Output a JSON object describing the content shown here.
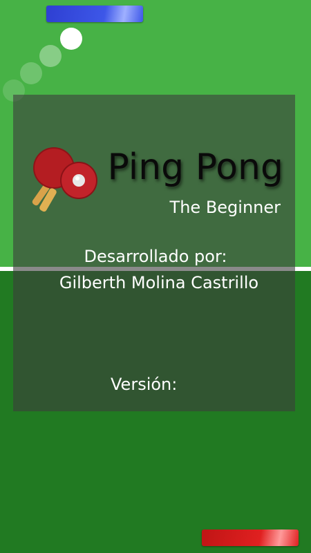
{
  "title": "Ping Pong",
  "subtitle": "The Beginner",
  "developed_by_label": "Desarrollado por:",
  "developer_name": "Gilberth Molina Castrillo",
  "version_label": "Versión:",
  "colors": {
    "field_top": "#47b246",
    "field_bottom": "#217a22",
    "paddle_top": "#3d57e8",
    "paddle_bottom": "#e02020",
    "ball": "#ffffff"
  },
  "icons": [
    "ping-pong-paddles-logo-icon"
  ]
}
